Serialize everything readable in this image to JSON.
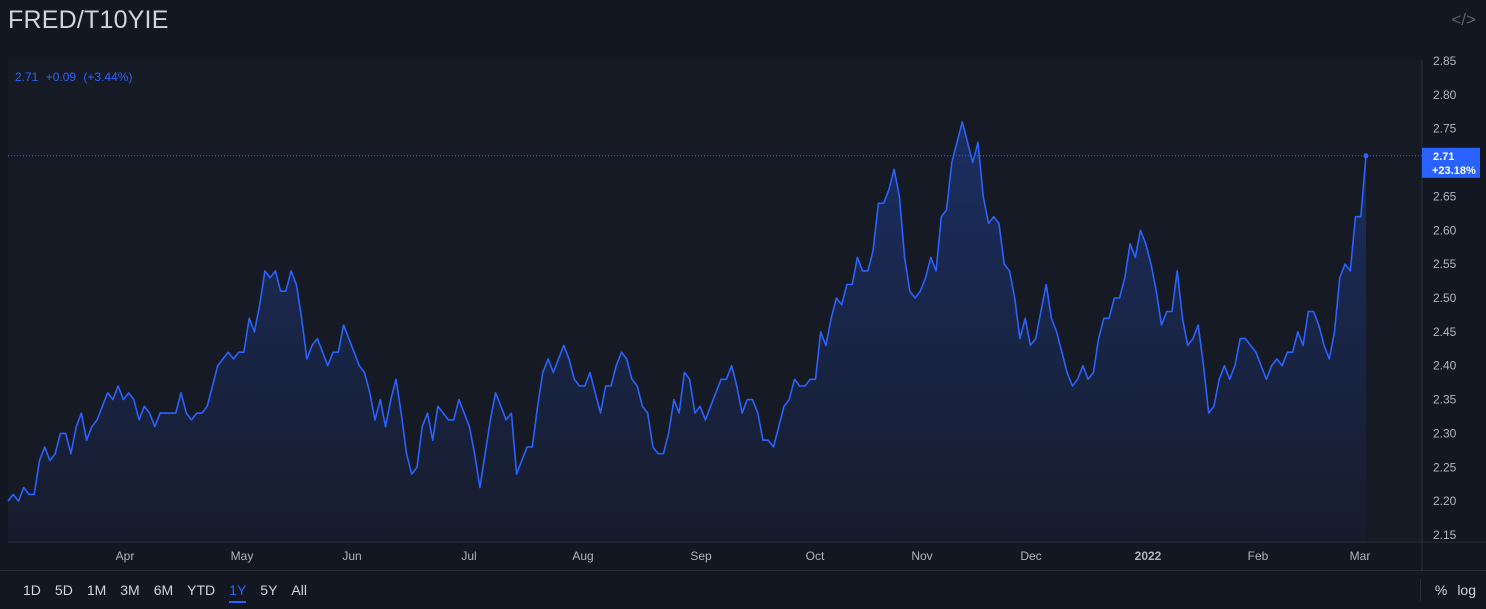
{
  "title": "FRED/T10YIE",
  "embed_icon": "code-icon",
  "legend": {
    "value": "2.71",
    "change": "+0.09",
    "change_pct": "(+3.44%)"
  },
  "price_label": {
    "value": "2.71",
    "change_pct": "+23.18%"
  },
  "colors": {
    "line": "#2962ff",
    "background": "#131722",
    "text": "#b2b5be",
    "grid": "#2a2e39"
  },
  "ranges": [
    "1D",
    "5D",
    "1M",
    "3M",
    "6M",
    "YTD",
    "1Y",
    "5Y",
    "All"
  ],
  "active_range": "1Y",
  "controls": {
    "percent": "%",
    "log": "log"
  },
  "chart_data": {
    "type": "area",
    "title": "FRED/T10YIE",
    "ylim": [
      2.15,
      2.85
    ],
    "yticks": [
      "2.85",
      "2.80",
      "2.75",
      "2.70",
      "2.65",
      "2.60",
      "2.55",
      "2.50",
      "2.45",
      "2.40",
      "2.35",
      "2.30",
      "2.25",
      "2.20",
      "2.15"
    ],
    "xticks": [
      "Apr",
      "May",
      "Jun",
      "Jul",
      "Aug",
      "Sep",
      "Oct",
      "Nov",
      "Dec",
      "2022",
      "Feb",
      "Mar"
    ],
    "grid": false,
    "series": [
      {
        "values": [
          2.2,
          2.21,
          2.2,
          2.22,
          2.21,
          2.21,
          2.26,
          2.28,
          2.26,
          2.27,
          2.3,
          2.3,
          2.27,
          2.31,
          2.33,
          2.29,
          2.31,
          2.32,
          2.34,
          2.36,
          2.35,
          2.37,
          2.35,
          2.36,
          2.35,
          2.32,
          2.34,
          2.33,
          2.31,
          2.33,
          2.33,
          2.33,
          2.33,
          2.36,
          2.33,
          2.32,
          2.33,
          2.33,
          2.34,
          2.37,
          2.4,
          2.41,
          2.42,
          2.41,
          2.42,
          2.42,
          2.47,
          2.45,
          2.49,
          2.54,
          2.53,
          2.54,
          2.51,
          2.51,
          2.54,
          2.52,
          2.47,
          2.41,
          2.43,
          2.44,
          2.42,
          2.4,
          2.42,
          2.42,
          2.46,
          2.44,
          2.42,
          2.4,
          2.39,
          2.36,
          2.32,
          2.35,
          2.31,
          2.35,
          2.38,
          2.33,
          2.27,
          2.24,
          2.25,
          2.31,
          2.33,
          2.29,
          2.34,
          2.33,
          2.32,
          2.32,
          2.35,
          2.33,
          2.31,
          2.27,
          2.22,
          2.27,
          2.32,
          2.36,
          2.34,
          2.32,
          2.33,
          2.24,
          2.26,
          2.28,
          2.28,
          2.34,
          2.39,
          2.41,
          2.39,
          2.41,
          2.43,
          2.41,
          2.38,
          2.37,
          2.37,
          2.39,
          2.36,
          2.33,
          2.37,
          2.37,
          2.4,
          2.42,
          2.41,
          2.38,
          2.37,
          2.34,
          2.33,
          2.28,
          2.27,
          2.27,
          2.3,
          2.35,
          2.33,
          2.39,
          2.38,
          2.33,
          2.34,
          2.32,
          2.34,
          2.36,
          2.38,
          2.38,
          2.4,
          2.37,
          2.33,
          2.35,
          2.35,
          2.33,
          2.29,
          2.29,
          2.28,
          2.31,
          2.34,
          2.35,
          2.38,
          2.37,
          2.37,
          2.38,
          2.38,
          2.45,
          2.43,
          2.47,
          2.5,
          2.49,
          2.52,
          2.52,
          2.56,
          2.54,
          2.54,
          2.57,
          2.64,
          2.64,
          2.66,
          2.69,
          2.65,
          2.56,
          2.51,
          2.5,
          2.51,
          2.53,
          2.56,
          2.54,
          2.62,
          2.63,
          2.7,
          2.73,
          2.76,
          2.73,
          2.7,
          2.73,
          2.65,
          2.61,
          2.62,
          2.61,
          2.55,
          2.54,
          2.5,
          2.44,
          2.47,
          2.43,
          2.44,
          2.48,
          2.52,
          2.47,
          2.45,
          2.42,
          2.39,
          2.37,
          2.38,
          2.4,
          2.38,
          2.39,
          2.44,
          2.47,
          2.47,
          2.5,
          2.5,
          2.53,
          2.58,
          2.56,
          2.6,
          2.58,
          2.55,
          2.51,
          2.46,
          2.48,
          2.48,
          2.54,
          2.47,
          2.43,
          2.44,
          2.46,
          2.4,
          2.33,
          2.34,
          2.38,
          2.4,
          2.38,
          2.4,
          2.44,
          2.44,
          2.43,
          2.42,
          2.4,
          2.38,
          2.4,
          2.41,
          2.4,
          2.42,
          2.42,
          2.45,
          2.43,
          2.48,
          2.48,
          2.46,
          2.43,
          2.41,
          2.45,
          2.53,
          2.55,
          2.54,
          2.62,
          2.62,
          2.71
        ]
      }
    ]
  }
}
